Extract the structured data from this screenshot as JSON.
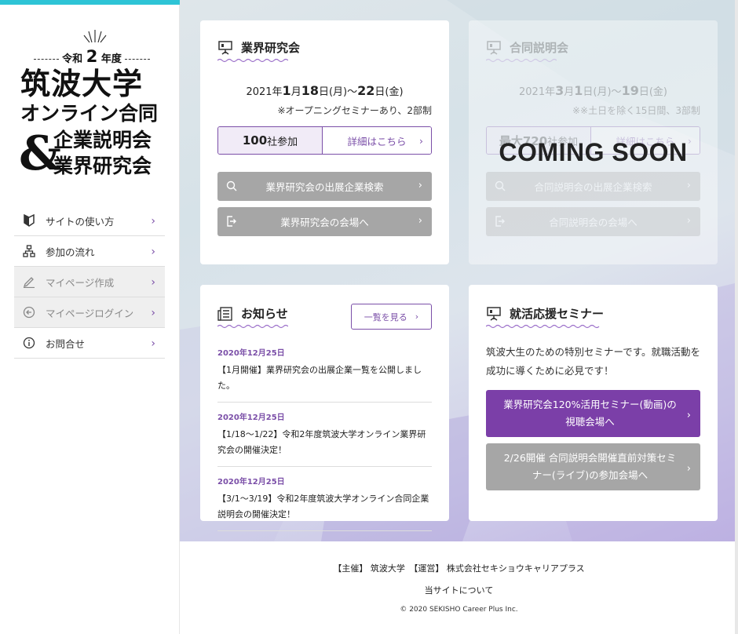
{
  "sidebar": {
    "logo": {
      "era_prefix": "令和",
      "era_num": "2",
      "era_suffix": "年度",
      "line1": "筑波大学",
      "line2": "オンライン合同",
      "amp": "&",
      "line3": "企業説明会",
      "line4": "業界研究会"
    },
    "nav": [
      {
        "label": "サイトの使い方",
        "icon": "beginner-mark-icon",
        "disabled": false
      },
      {
        "label": "参加の流れ",
        "icon": "flow-chart-icon",
        "disabled": false
      },
      {
        "label": "マイページ作成",
        "icon": "pen-icon",
        "disabled": true
      },
      {
        "label": "マイページログイン",
        "icon": "login-icon",
        "disabled": true
      },
      {
        "label": "お問合せ",
        "icon": "info-icon",
        "disabled": false
      }
    ]
  },
  "research": {
    "title": "業界研究会",
    "date_prefix": "2021年",
    "date_m1": "1",
    "date_mm": "月",
    "date_d1": "18",
    "date_mid": "日(月)～",
    "date_d2": "22",
    "date_suffix": "日(金)",
    "note": "※オープニングセミナーあり、2部制",
    "count_num": "100",
    "count_suffix": "社参加",
    "detail_label": "詳細はこちら",
    "search_label": "業界研究会の出展企業検索",
    "venue_label": "業界研究会の会場へ"
  },
  "joint": {
    "title": "合同説明会",
    "date_prefix": "2021年",
    "date_m1": "3",
    "date_mm": "月",
    "date_d1": "1",
    "date_mid": "日(月)～",
    "date_d2": "19",
    "date_suffix": "日(金)",
    "note": "※※土日を除く15日間、3部制",
    "count_num": "最大720",
    "count_suffix": "社参加",
    "detail_label": "詳細はこちら",
    "search_label": "合同説明会の出展企業検索",
    "venue_label": "合同説明会の会場へ",
    "coming_soon": "COMING SOON"
  },
  "news": {
    "title": "お知らせ",
    "all_label": "一覧を見る",
    "items": [
      {
        "date": "2020年12月25日",
        "text": "【1月開催】業界研究会の出展企業一覧を公開しました。"
      },
      {
        "date": "2020年12月25日",
        "text": "【1/18～1/22】令和2年度筑波大学オンライン業界研究会の開催決定！"
      },
      {
        "date": "2020年12月25日",
        "text": "【3/1～3/19】令和2年度筑波大学オンライン合同企業説明会の開催決定！"
      }
    ]
  },
  "seminar": {
    "title": "就活応援セミナー",
    "desc": "筑波大生のための特別セミナーです。就職活動を成功に導くために必見です！",
    "btn1": "業界研究会120%活用セミナー(動画)の視聴会場へ",
    "btn2": "2/26開催 合同説明会開催直前対策セミナー(ライブ)の参加会場へ"
  },
  "footer": {
    "line1": "【主催】 筑波大学　【運営】 株式会社セキショウキャリアプラス",
    "line2": "当サイトについて",
    "line3": "© 2020 SEKISHO Career Plus Inc."
  },
  "colors": {
    "accent_purple": "#7b3fa8",
    "top_bar_cyan": "#2ec4d6",
    "button_gray": "#a6a6a6"
  }
}
